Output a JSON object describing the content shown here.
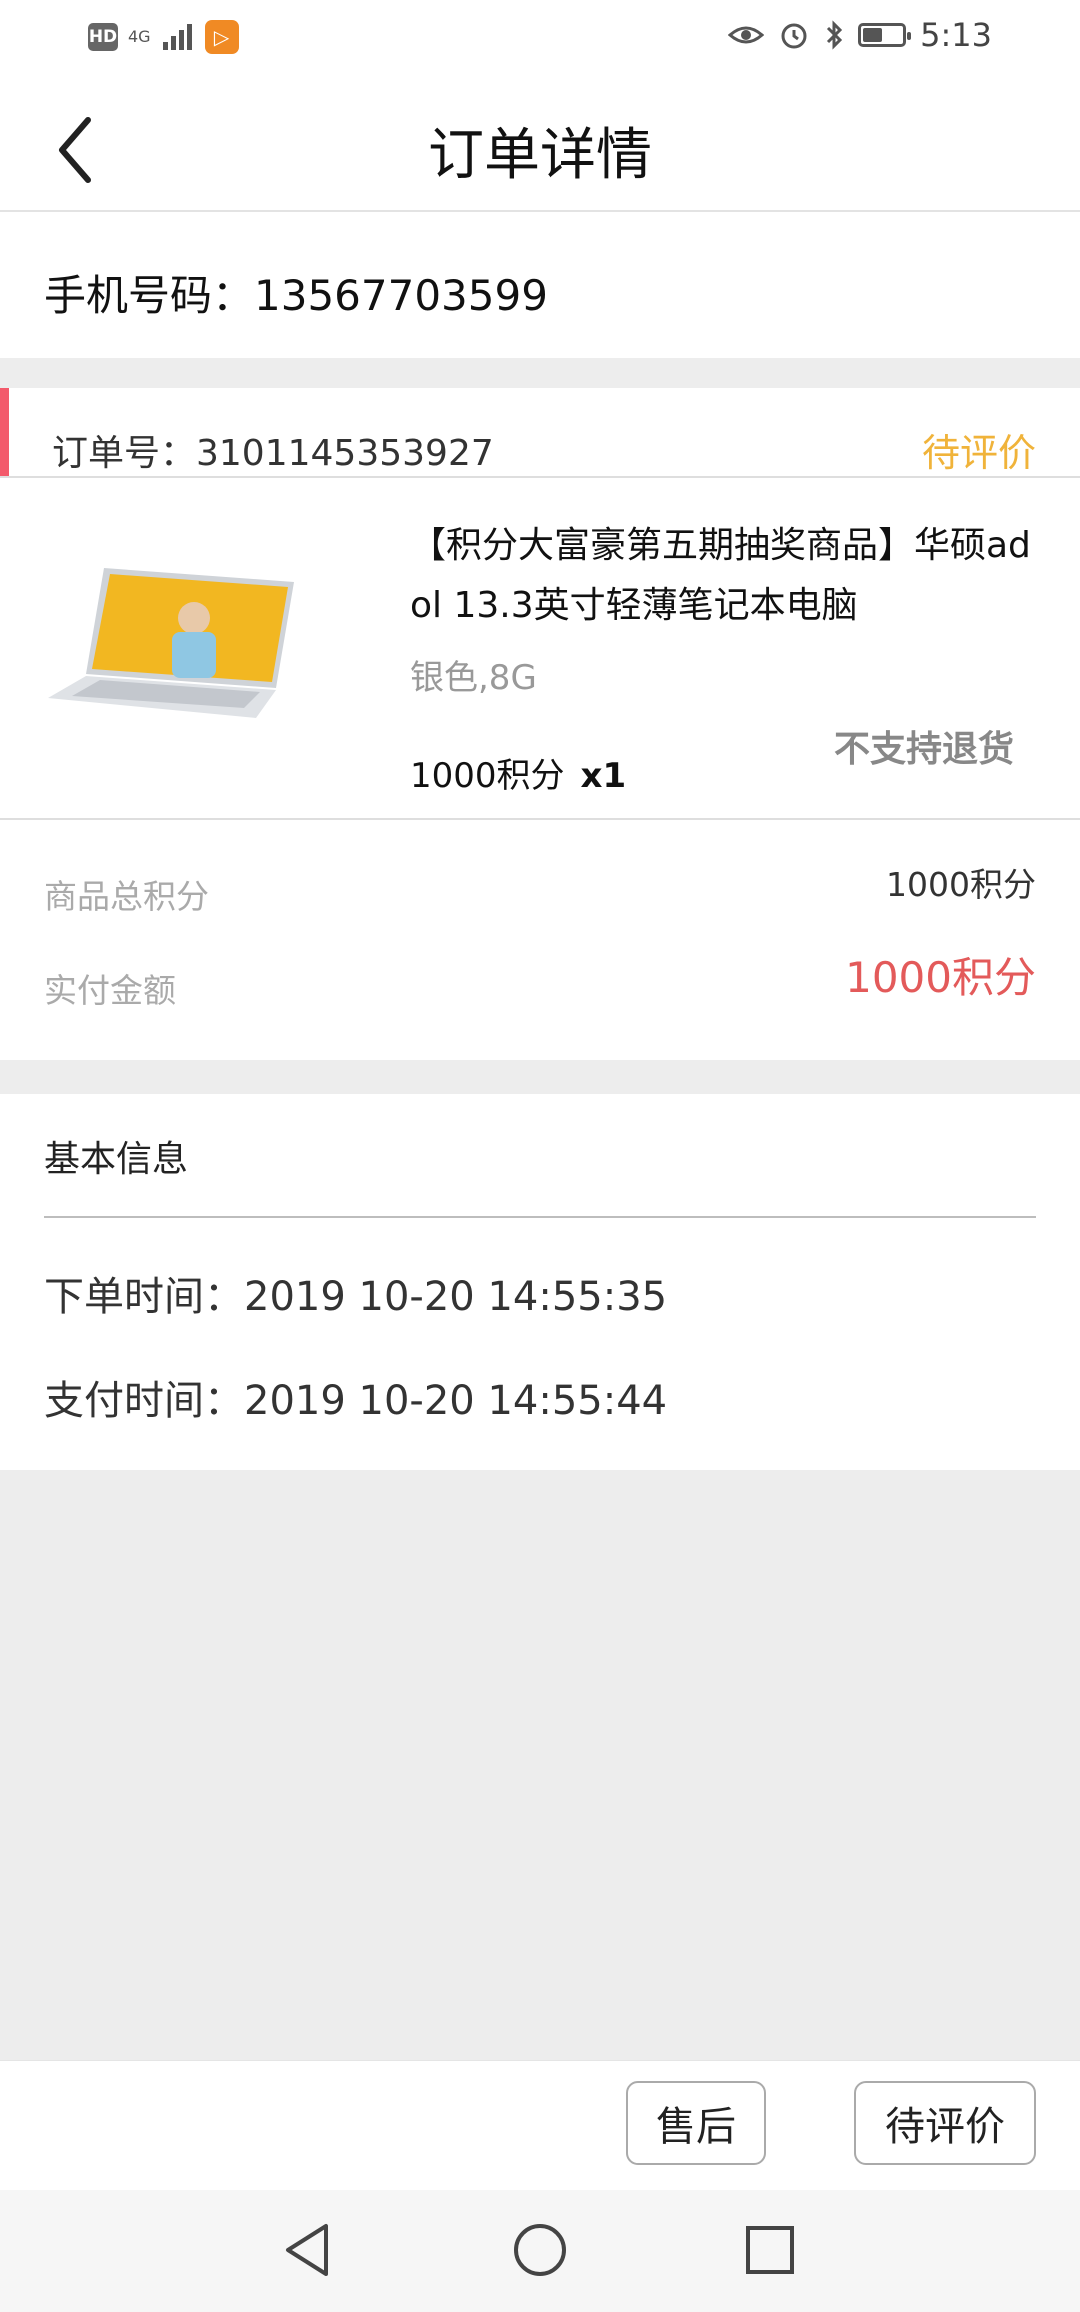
{
  "status_bar": {
    "hd": "HD",
    "network": "4G",
    "time": "5:13",
    "battery_level": 0.5
  },
  "header": {
    "title": "订单详情",
    "back_icon": "chevron-left-icon"
  },
  "phone": {
    "label": "手机号码：13567703599"
  },
  "order": {
    "number_label": "订单号：3101145353927",
    "status": "待评价",
    "product": {
      "title": "【积分大富豪第五期抽奖商品】华硕adol 13.3英寸轻薄笔记本电脑",
      "spec": "银色,8G",
      "price": "1000积分",
      "quantity": "x1",
      "return_policy": "不支持退货"
    },
    "summary": {
      "total_label": "商品总积分",
      "total_value": "1000积分",
      "paid_label": "实付金额",
      "paid_value": "1000积分"
    }
  },
  "basic_info": {
    "title": "基本信息",
    "order_time": "下单时间：2019 10-20 14:55:35",
    "pay_time": "支付时间：2019 10-20 14:55:44"
  },
  "actions": {
    "after_sale": "售后",
    "review": "待评价"
  },
  "colors": {
    "accent_red": "#f35a6b",
    "status_yellow": "#f0b33a",
    "price_red": "#e35a5a"
  }
}
